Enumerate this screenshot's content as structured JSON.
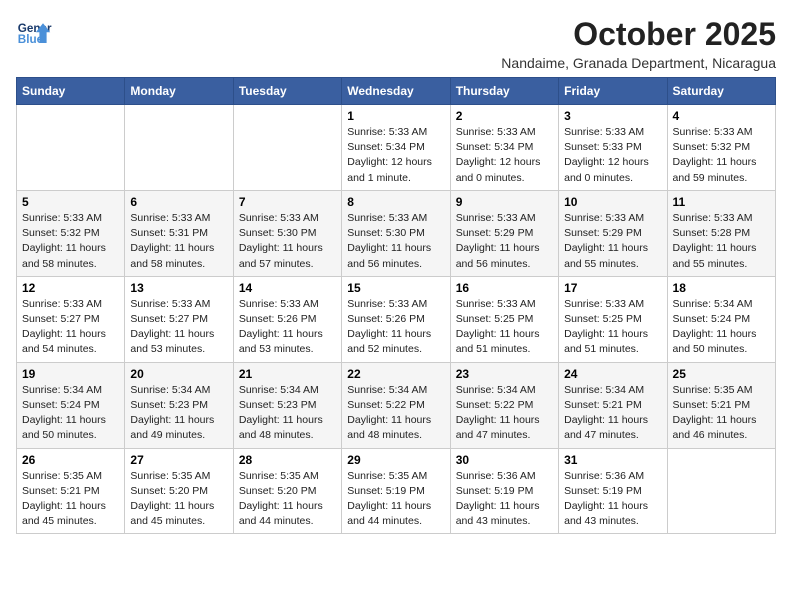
{
  "header": {
    "logo_line1": "General",
    "logo_line2": "Blue",
    "month": "October 2025",
    "location": "Nandaime, Granada Department, Nicaragua"
  },
  "weekdays": [
    "Sunday",
    "Monday",
    "Tuesday",
    "Wednesday",
    "Thursday",
    "Friday",
    "Saturday"
  ],
  "weeks": [
    [
      {
        "day": "",
        "info": ""
      },
      {
        "day": "",
        "info": ""
      },
      {
        "day": "",
        "info": ""
      },
      {
        "day": "1",
        "info": "Sunrise: 5:33 AM\nSunset: 5:34 PM\nDaylight: 12 hours\nand 1 minute."
      },
      {
        "day": "2",
        "info": "Sunrise: 5:33 AM\nSunset: 5:34 PM\nDaylight: 12 hours\nand 0 minutes."
      },
      {
        "day": "3",
        "info": "Sunrise: 5:33 AM\nSunset: 5:33 PM\nDaylight: 12 hours\nand 0 minutes."
      },
      {
        "day": "4",
        "info": "Sunrise: 5:33 AM\nSunset: 5:32 PM\nDaylight: 11 hours\nand 59 minutes."
      }
    ],
    [
      {
        "day": "5",
        "info": "Sunrise: 5:33 AM\nSunset: 5:32 PM\nDaylight: 11 hours\nand 58 minutes."
      },
      {
        "day": "6",
        "info": "Sunrise: 5:33 AM\nSunset: 5:31 PM\nDaylight: 11 hours\nand 58 minutes."
      },
      {
        "day": "7",
        "info": "Sunrise: 5:33 AM\nSunset: 5:30 PM\nDaylight: 11 hours\nand 57 minutes."
      },
      {
        "day": "8",
        "info": "Sunrise: 5:33 AM\nSunset: 5:30 PM\nDaylight: 11 hours\nand 56 minutes."
      },
      {
        "day": "9",
        "info": "Sunrise: 5:33 AM\nSunset: 5:29 PM\nDaylight: 11 hours\nand 56 minutes."
      },
      {
        "day": "10",
        "info": "Sunrise: 5:33 AM\nSunset: 5:29 PM\nDaylight: 11 hours\nand 55 minutes."
      },
      {
        "day": "11",
        "info": "Sunrise: 5:33 AM\nSunset: 5:28 PM\nDaylight: 11 hours\nand 55 minutes."
      }
    ],
    [
      {
        "day": "12",
        "info": "Sunrise: 5:33 AM\nSunset: 5:27 PM\nDaylight: 11 hours\nand 54 minutes."
      },
      {
        "day": "13",
        "info": "Sunrise: 5:33 AM\nSunset: 5:27 PM\nDaylight: 11 hours\nand 53 minutes."
      },
      {
        "day": "14",
        "info": "Sunrise: 5:33 AM\nSunset: 5:26 PM\nDaylight: 11 hours\nand 53 minutes."
      },
      {
        "day": "15",
        "info": "Sunrise: 5:33 AM\nSunset: 5:26 PM\nDaylight: 11 hours\nand 52 minutes."
      },
      {
        "day": "16",
        "info": "Sunrise: 5:33 AM\nSunset: 5:25 PM\nDaylight: 11 hours\nand 51 minutes."
      },
      {
        "day": "17",
        "info": "Sunrise: 5:33 AM\nSunset: 5:25 PM\nDaylight: 11 hours\nand 51 minutes."
      },
      {
        "day": "18",
        "info": "Sunrise: 5:34 AM\nSunset: 5:24 PM\nDaylight: 11 hours\nand 50 minutes."
      }
    ],
    [
      {
        "day": "19",
        "info": "Sunrise: 5:34 AM\nSunset: 5:24 PM\nDaylight: 11 hours\nand 50 minutes."
      },
      {
        "day": "20",
        "info": "Sunrise: 5:34 AM\nSunset: 5:23 PM\nDaylight: 11 hours\nand 49 minutes."
      },
      {
        "day": "21",
        "info": "Sunrise: 5:34 AM\nSunset: 5:23 PM\nDaylight: 11 hours\nand 48 minutes."
      },
      {
        "day": "22",
        "info": "Sunrise: 5:34 AM\nSunset: 5:22 PM\nDaylight: 11 hours\nand 48 minutes."
      },
      {
        "day": "23",
        "info": "Sunrise: 5:34 AM\nSunset: 5:22 PM\nDaylight: 11 hours\nand 47 minutes."
      },
      {
        "day": "24",
        "info": "Sunrise: 5:34 AM\nSunset: 5:21 PM\nDaylight: 11 hours\nand 47 minutes."
      },
      {
        "day": "25",
        "info": "Sunrise: 5:35 AM\nSunset: 5:21 PM\nDaylight: 11 hours\nand 46 minutes."
      }
    ],
    [
      {
        "day": "26",
        "info": "Sunrise: 5:35 AM\nSunset: 5:21 PM\nDaylight: 11 hours\nand 45 minutes."
      },
      {
        "day": "27",
        "info": "Sunrise: 5:35 AM\nSunset: 5:20 PM\nDaylight: 11 hours\nand 45 minutes."
      },
      {
        "day": "28",
        "info": "Sunrise: 5:35 AM\nSunset: 5:20 PM\nDaylight: 11 hours\nand 44 minutes."
      },
      {
        "day": "29",
        "info": "Sunrise: 5:35 AM\nSunset: 5:19 PM\nDaylight: 11 hours\nand 44 minutes."
      },
      {
        "day": "30",
        "info": "Sunrise: 5:36 AM\nSunset: 5:19 PM\nDaylight: 11 hours\nand 43 minutes."
      },
      {
        "day": "31",
        "info": "Sunrise: 5:36 AM\nSunset: 5:19 PM\nDaylight: 11 hours\nand 43 minutes."
      },
      {
        "day": "",
        "info": ""
      }
    ]
  ]
}
